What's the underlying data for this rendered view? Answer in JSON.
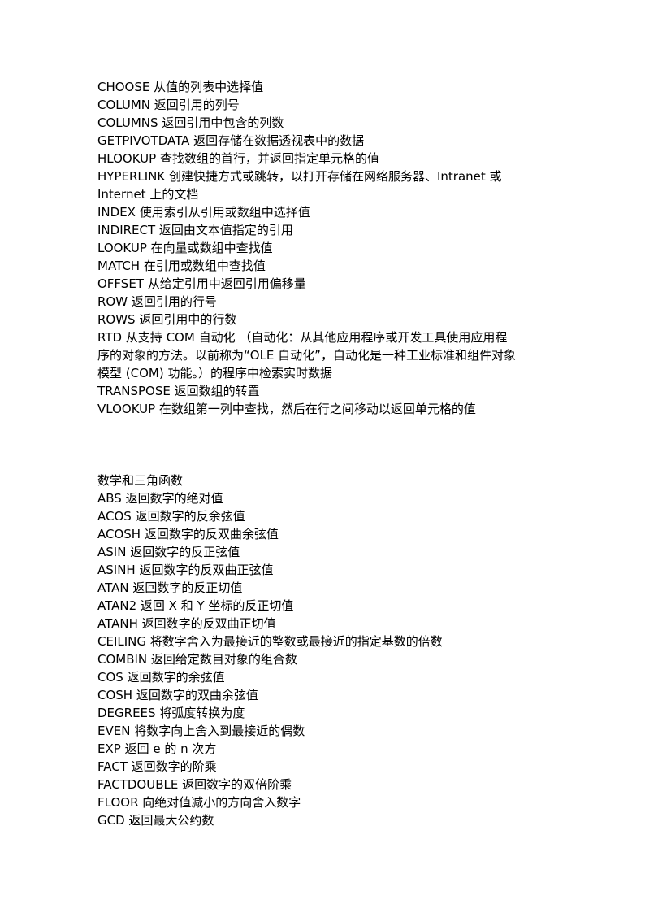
{
  "section_lookup": {
    "items": [
      "CHOOSE 从值的列表中选择值",
      "COLUMN 返回引用的列号",
      "COLUMNS 返回引用中包含的列数",
      "GETPIVOTDATA 返回存储在数据透视表中的数据",
      "HLOOKUP 查找数组的首行，并返回指定单元格的值",
      "HYPERLINK 创建快捷方式或跳转，以打开存储在网络服务器、Intranet 或",
      "Internet 上的文档",
      "INDEX 使用索引从引用或数组中选择值",
      "INDIRECT 返回由文本值指定的引用",
      "LOOKUP 在向量或数组中查找值",
      "MATCH 在引用或数组中查找值",
      "OFFSET 从给定引用中返回引用偏移量",
      "ROW 返回引用的行号",
      "ROWS 返回引用中的行数",
      "RTD 从支持 COM 自动化 （自动化：从其他应用程序或开发工具使用应用程",
      "序的对象的方法。以前称为“OLE 自动化”，自动化是一种工业标准和组件对象",
      "模型 (COM) 功能。）的程序中检索实时数据",
      "TRANSPOSE 返回数组的转置",
      "VLOOKUP 在数组第一列中查找，然后在行之间移动以返回单元格的值"
    ]
  },
  "section_math": {
    "heading": "数学和三角函数",
    "items": [
      "ABS 返回数字的绝对值",
      "ACOS 返回数字的反余弦值",
      "ACOSH 返回数字的反双曲余弦值",
      "ASIN 返回数字的反正弦值",
      "ASINH 返回数字的反双曲正弦值",
      "ATAN 返回数字的反正切值",
      "ATAN2 返回 X 和 Y 坐标的反正切值",
      "ATANH 返回数字的反双曲正切值",
      "CEILING 将数字舍入为最接近的整数或最接近的指定基数的倍数",
      "COMBIN 返回给定数目对象的组合数",
      "COS 返回数字的余弦值",
      "COSH 返回数字的双曲余弦值",
      "DEGREES 将弧度转换为度",
      "EVEN 将数字向上舍入到最接近的偶数",
      "EXP 返回 e 的 n 次方",
      "FACT 返回数字的阶乘",
      "FACTDOUBLE 返回数字的双倍阶乘",
      "FLOOR 向绝对值减小的方向舍入数字",
      "GCD 返回最大公约数"
    ]
  }
}
